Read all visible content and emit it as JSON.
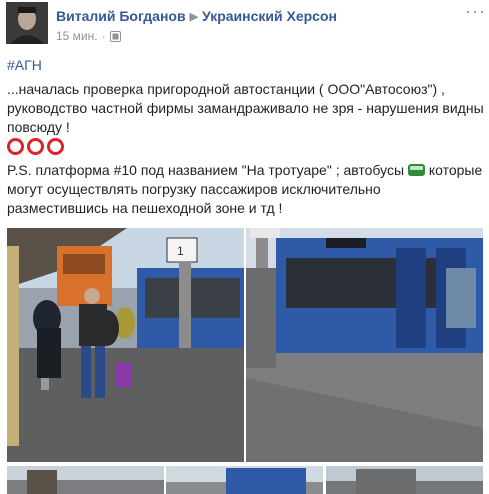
{
  "post": {
    "author": "Виталий Богданов",
    "group": "Украинский Херсон",
    "time": "15 мин.",
    "menu_label": "···",
    "hashtag": "#АГН",
    "paragraph1": "...началась проверка пригородной автостанции ( ООО\"Автосоюз\") , руководство частной фирмы замандраживало не зря - нарушения видны повсюду !",
    "ps_line1": "P.S. платформа #10 под названием \"На тротуаре\" ; автобусы",
    "ps_line2": "которые могут осуществлять погрузку пассажиров исключительно разместившись на пешеходной зоне и тд !",
    "sign_text": "1",
    "circles_icon": "red-circle-icon",
    "bus_icon": "bus-emoji-icon",
    "privacy_icon": "globe-privacy-icon"
  },
  "colors": {
    "link": "#365899",
    "text": "#1d2129",
    "meta": "#90949c",
    "circle": "#e0222b",
    "bus": "#2f5aa8"
  }
}
